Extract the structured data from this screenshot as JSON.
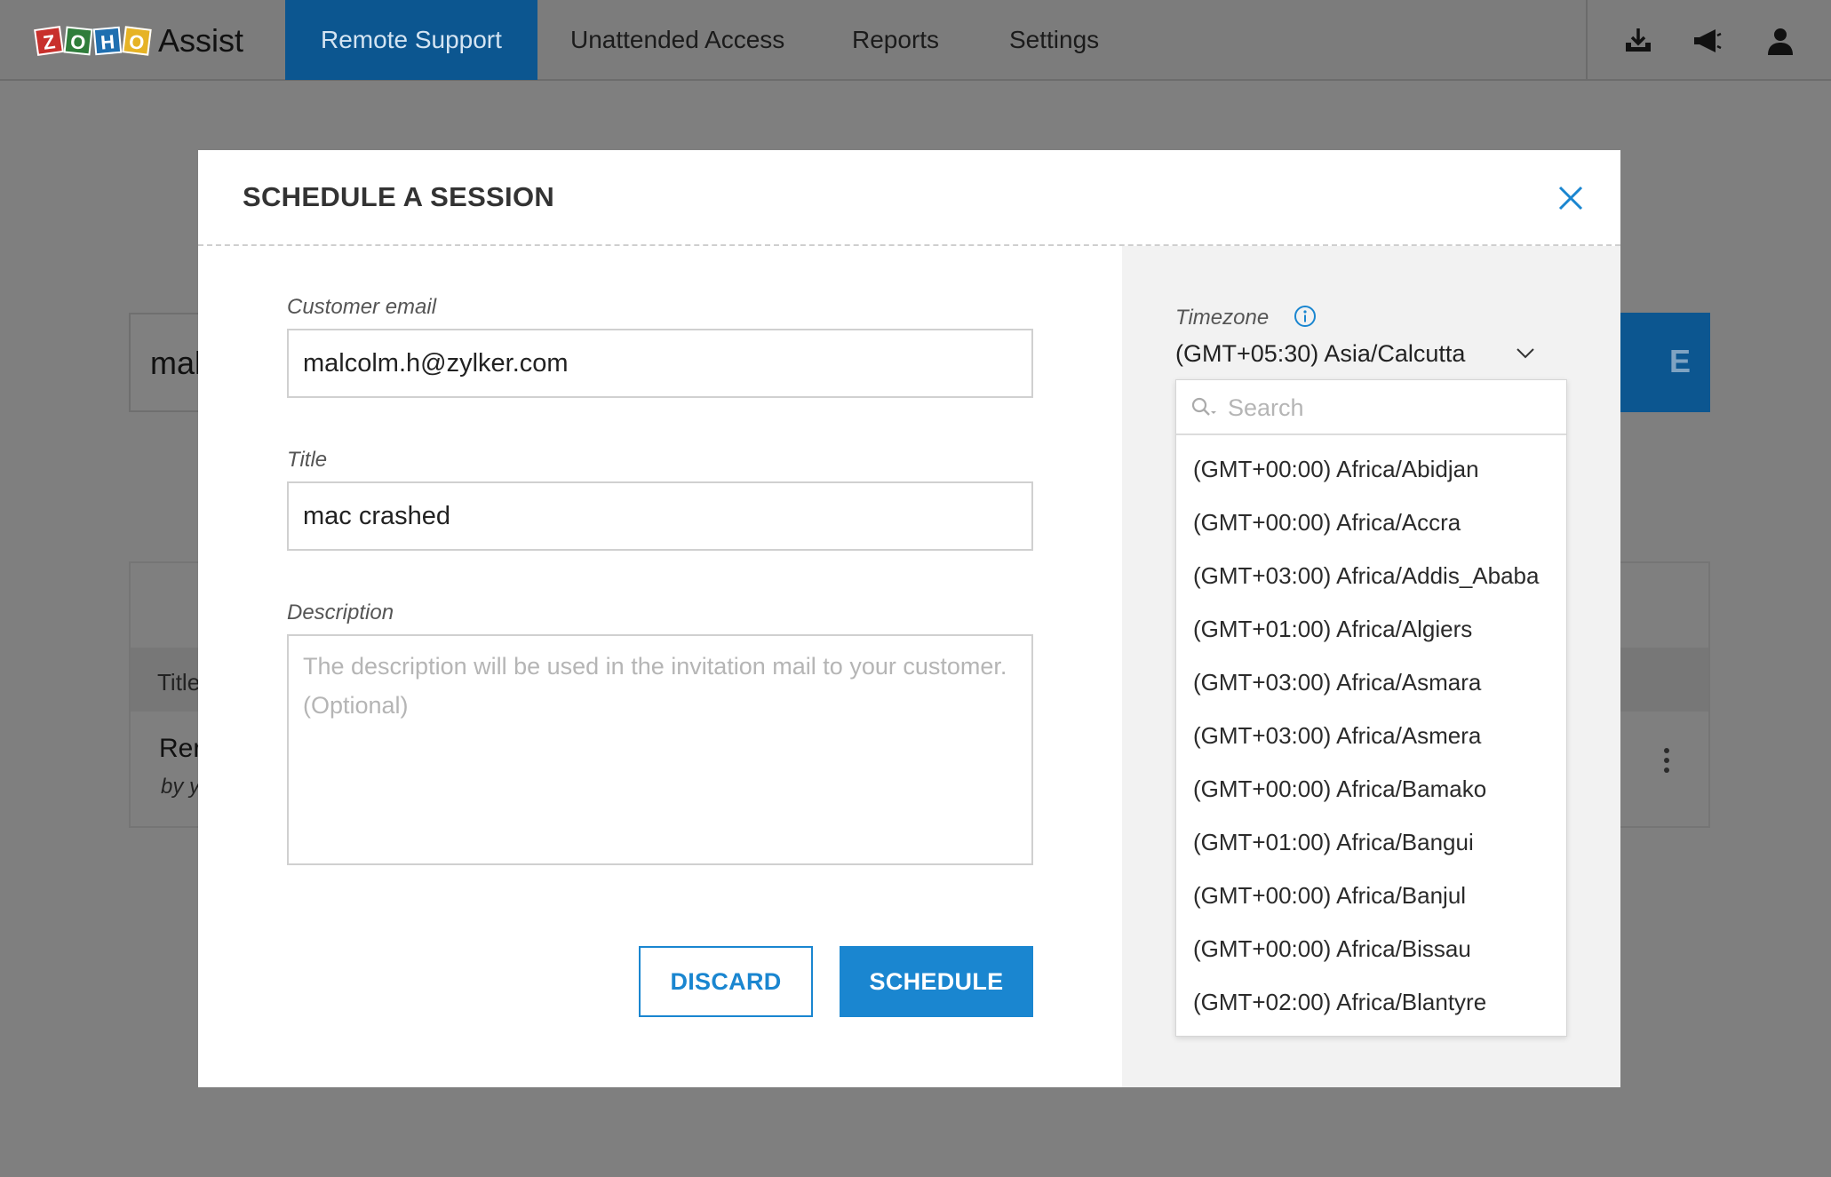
{
  "app": {
    "logo_letters": [
      "Z",
      "O",
      "H",
      "O"
    ],
    "logo_word": "Assist"
  },
  "nav": {
    "tabs": [
      {
        "label": "Remote Support",
        "active": true
      },
      {
        "label": "Unattended Access",
        "active": false
      },
      {
        "label": "Reports",
        "active": false
      },
      {
        "label": "Settings",
        "active": false
      }
    ],
    "icons": [
      "download-icon",
      "announcement-icon",
      "user-icon"
    ]
  },
  "background": {
    "search_value_fragment": "mal",
    "button_fragment": "E",
    "table_header_fragment": "Title",
    "row_title_fragment": "Rer",
    "row_by_fragment": "by yo"
  },
  "modal": {
    "title": "SCHEDULE A SESSION",
    "email_label": "Customer email",
    "email_value": "malcolm.h@zylker.com",
    "title_label": "Title",
    "title_value": "mac crashed",
    "description_label": "Description",
    "description_placeholder": "The description will be used in the invitation mail to your customer. (Optional)",
    "discard_label": "DISCARD",
    "schedule_label": "SCHEDULE"
  },
  "timezone": {
    "label": "Timezone",
    "selected": "(GMT+05:30) Asia/Calcutta",
    "search_placeholder": "Search",
    "options": [
      "(GMT+00:00) Africa/Abidjan",
      "(GMT+00:00) Africa/Accra",
      "(GMT+03:00) Africa/Addis_Ababa",
      "(GMT+01:00) Africa/Algiers",
      "(GMT+03:00) Africa/Asmara",
      "(GMT+03:00) Africa/Asmera",
      "(GMT+00:00) Africa/Bamako",
      "(GMT+01:00) Africa/Bangui",
      "(GMT+00:00) Africa/Banjul",
      "(GMT+00:00) Africa/Bissau",
      "(GMT+02:00) Africa/Blantyre"
    ]
  },
  "colors": {
    "accent": "#1a86d0",
    "nav_active": "#0c5690",
    "overlay": "#7f7f7f"
  }
}
